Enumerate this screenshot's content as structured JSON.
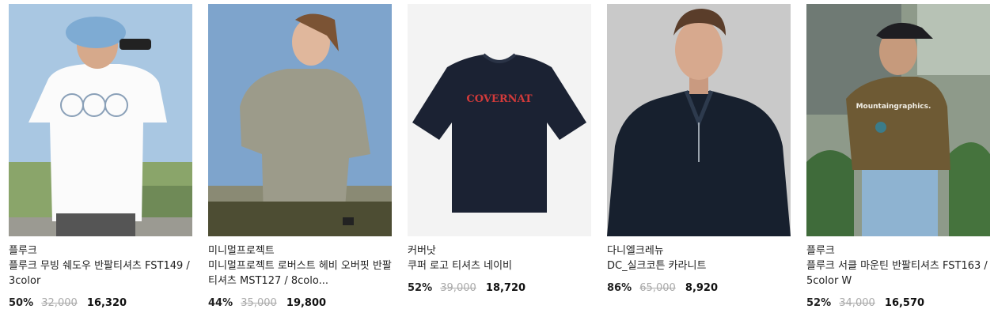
{
  "products": [
    {
      "brand": "플루크",
      "name": "플루크 무빙 쉐도우 반팔티셔츠 FST149 / 3color",
      "discount": "50%",
      "original": "32,000",
      "price": "16,320",
      "image": "woman-white-tee-binoculars",
      "print": ""
    },
    {
      "brand": "미니멀프로젝트",
      "name": "미니멀프로젝트 로버스트 헤비 오버핏 반팔티셔츠 MST127 / 8colo...",
      "discount": "44%",
      "original": "35,000",
      "price": "19,800",
      "image": "man-sage-tee",
      "print": ""
    },
    {
      "brand": "커버낫",
      "name": "쿠퍼 로고 티셔츠 네이비",
      "discount": "52%",
      "original": "39,000",
      "price": "18,720",
      "image": "navy-tee-product",
      "print": "COVERNAT"
    },
    {
      "brand": "다니엘크레뉴",
      "name": "DC_실크코튼 카라니트",
      "discount": "86%",
      "original": "65,000",
      "price": "8,920",
      "image": "man-navy-polo-knit",
      "print": ""
    },
    {
      "brand": "플루크",
      "name": "플루크 서클 마운틴 반팔티셔츠 FST163 / 5color W",
      "discount": "52%",
      "original": "34,000",
      "price": "16,570",
      "image": "woman-olive-tee-back",
      "print": "Mountaingraphics."
    }
  ]
}
